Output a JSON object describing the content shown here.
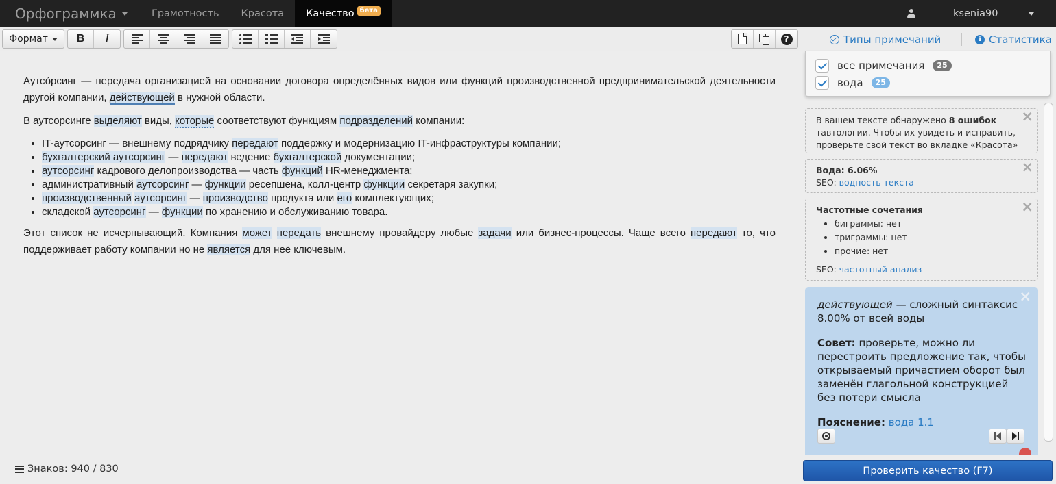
{
  "navbar": {
    "brand": "Орфограммка",
    "tabs": [
      {
        "label": "Грамотность"
      },
      {
        "label": "Красота"
      },
      {
        "label": "Качество",
        "badge": "бета"
      }
    ],
    "username": "ksenia90"
  },
  "toolbar": {
    "format_label": "Формат",
    "bold_label": "B",
    "italic_label": "I",
    "help_label": "?",
    "note_types_label": "Типы примечаний",
    "stats_label": "Статистика",
    "info_label": "i"
  },
  "editor": {
    "p1": {
      "a": "Аутсо́рсинг — передача организацией на основании договора определённых видов или функций производственной предпринимательской деятельности другой компании, ",
      "h1": "действующей",
      "b": " в нужной области."
    },
    "p2": {
      "a": "В аутсорсинге ",
      "h1": "выделяют",
      "b": " виды, ",
      "h2": "которые",
      "c": " соответствуют функциям ",
      "h3": "подразделений",
      "d": " компании:"
    },
    "list": {
      "i1": {
        "a": "IT-аутсорсинг — внешнему подрядчику ",
        "h1": "передают",
        "b": " поддержку и модернизацию IT-инфраструктуры компании;"
      },
      "i2": {
        "h1": "бухгалтерский аутсорсинг",
        "a": " — ",
        "h2": "передают",
        "b": " ведение ",
        "h3": "бухгалтерской",
        "c": " документации;"
      },
      "i3": {
        "h1": "аутсорсинг",
        "a": " кадрового делопроизводства — часть ",
        "h2": "функций",
        "b": " HR-менеджмента;"
      },
      "i4": {
        "a": "административный ",
        "h1": "аутсорсинг",
        "b": " — ",
        "h2": "функции",
        "c": " ресепшена, колл-центр ",
        "h3": "функции",
        "d": " секретаря закупки;"
      },
      "i5": {
        "h1": "производственный",
        "a": " ",
        "h2": "аутсорсинг",
        "b": " — ",
        "h3": "производство",
        "c": " продукта или ",
        "h4": "его",
        "d": " комплектующих;"
      },
      "i6": {
        "a": "складской ",
        "h1": "аутсорсинг",
        "b": " — ",
        "h2": "функции",
        "c": " по хранению и обслуживанию товара."
      }
    },
    "p3": {
      "a": "Этот список не исчерпывающий. Компания ",
      "h1": "может",
      "s1": " ",
      "h2": "передать",
      "b": " внешнему провайдеру любые ",
      "h3": "задачи",
      "c": " или бизнес-процессы. Чаще всего ",
      "h4": "передают",
      "d": " то, что поддерживает работу компании но не ",
      "h5": "является",
      "e": " для неё ключевым."
    }
  },
  "filters": [
    {
      "label": "все примечания",
      "count": "25"
    },
    {
      "label": "вода",
      "count": "25"
    }
  ],
  "cards": {
    "tautology": {
      "a": "В вашем тексте обнаружено ",
      "bold": "8 ошибок",
      "b": " тавтологии. Чтобы их увидеть и исправить, проверьте свой текст во вкладке «Красота»"
    },
    "water": {
      "title": "Вода: 6.06%",
      "seo_label": "SEO: ",
      "seo_link": "водность текста"
    },
    "frequency": {
      "title": "Частотные сочетания",
      "items": [
        "биграммы: нет",
        "триграммы: нет",
        "прочие: нет"
      ],
      "seo_label": "SEO: ",
      "seo_link": "частотный анализ"
    },
    "close_symbol": "×"
  },
  "tip": {
    "word": "действующей",
    "headline": " — сложный синтаксис",
    "percent": "8.00% от всей воды",
    "advice_label": "Совет:",
    "advice": " проверьте, можно ли перестроить предложение так, чтобы открываемый причастием оборот был заменён глагольной конструкцией без потери смысла",
    "explain_label": "Пояснение:",
    "explain_link": "вода 1.1"
  },
  "footer": {
    "counter": "Знаков: 940 / 830",
    "check_button": "Проверить качество (F7)"
  },
  "colors": {
    "navbar_bg": "#222222",
    "highlight": "#d4e2f0",
    "link": "#2a7bc3",
    "tip_bg": "#bed6ed",
    "button": "#2d73c6",
    "beta_badge": "#f0ad4e"
  }
}
